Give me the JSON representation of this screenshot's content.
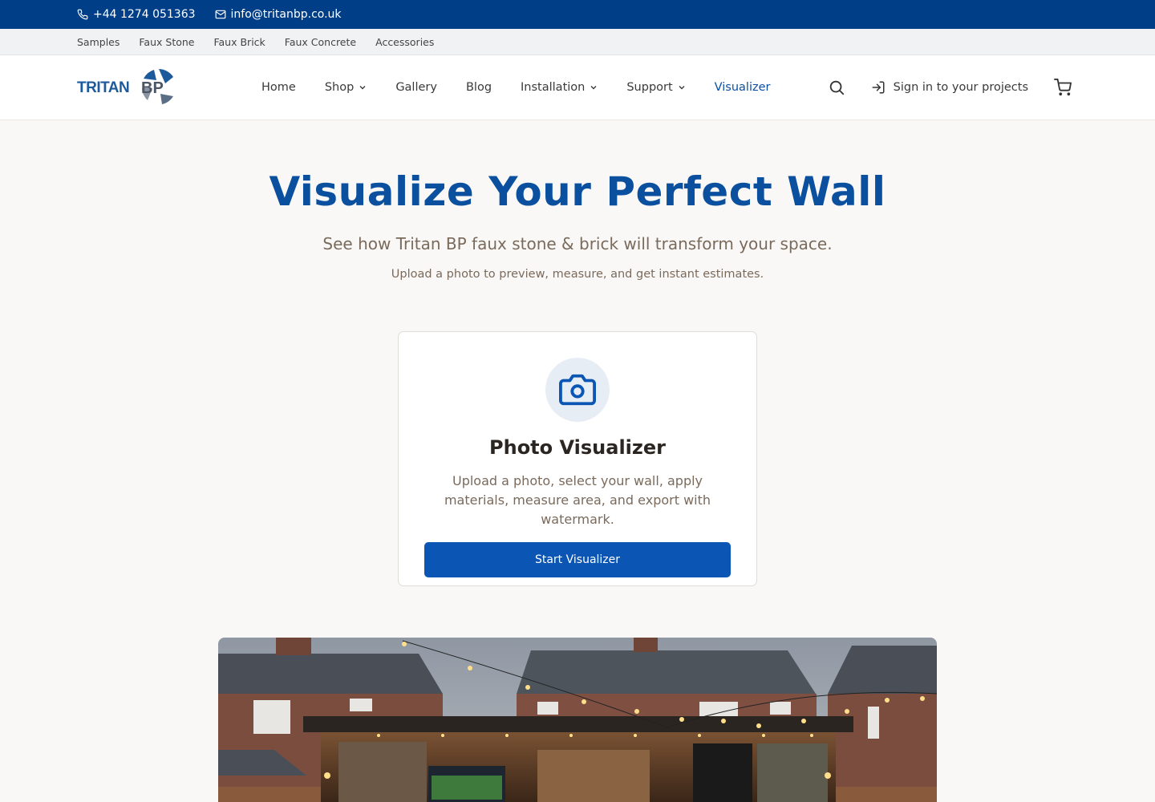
{
  "topbar": {
    "phone": "+44 1274 051363",
    "email": "info@tritanbp.co.uk"
  },
  "subnav": [
    "Samples",
    "Faux Stone",
    "Faux Brick",
    "Faux Concrete",
    "Accessories"
  ],
  "header": {
    "logo_text": "TRITAN BP",
    "nav": {
      "home": "Home",
      "shop": "Shop",
      "gallery": "Gallery",
      "blog": "Blog",
      "installation": "Installation",
      "support": "Support",
      "visualizer": "Visualizer"
    },
    "signin_label": "Sign in to your projects"
  },
  "hero": {
    "title": "Visualize Your Perfect Wall",
    "subtitle": "See how Tritan BP faux stone & brick will transform your space.",
    "subtext": "Upload a photo to preview, measure, and get instant estimates."
  },
  "card": {
    "title": "Photo Visualizer",
    "description": "Upload a photo, select your wall, apply materials, measure area, and export with watermark.",
    "button_label": "Start Visualizer"
  },
  "colors": {
    "brand_blue": "#003f88",
    "accent_blue": "#0b55b5",
    "text_brown": "#7a6a5c"
  },
  "icons": {
    "phone": "phone-icon",
    "email": "mail-icon",
    "search": "search-icon",
    "signin": "sign-in-icon",
    "cart": "cart-icon",
    "camera": "camera-icon"
  }
}
